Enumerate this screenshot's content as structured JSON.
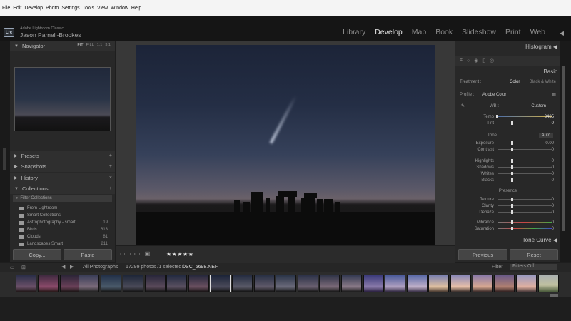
{
  "menubar": {
    "items": [
      "File",
      "Edit",
      "Develop",
      "Photo",
      "Settings",
      "Tools",
      "View",
      "Window",
      "Help"
    ]
  },
  "identity": {
    "logo": "Lrc",
    "app_name": "Adobe Lightroom Classic",
    "user": "Jason Parnell-Brookes"
  },
  "modules": {
    "items": [
      "Library",
      "Develop",
      "Map",
      "Book",
      "Slideshow",
      "Print",
      "Web"
    ],
    "active": "Develop"
  },
  "left": {
    "navigator": {
      "label": "Navigator",
      "options": [
        "FIT",
        "FILL",
        "1:1",
        "3:1"
      ]
    },
    "panels": [
      "Presets",
      "Snapshots",
      "History",
      "Collections"
    ],
    "filter_collections": "Filter Collections",
    "collections": [
      {
        "name": "From Lightroom",
        "count": ""
      },
      {
        "name": "Smart Collections",
        "count": ""
      },
      {
        "name": "Astrophotography - smart",
        "count": "19"
      },
      {
        "name": "Birds",
        "count": "613"
      },
      {
        "name": "Clouds",
        "count": "81"
      },
      {
        "name": "Landscapes Smart",
        "count": "211"
      }
    ],
    "copy": "Copy...",
    "paste": "Paste"
  },
  "center": {
    "rating": "★★★★★"
  },
  "right": {
    "histogram": "Histogram",
    "basic": "Basic",
    "treatment": {
      "label": "Treatment :",
      "color": "Color",
      "bw": "Black & White"
    },
    "profile": {
      "label": "Profile :",
      "value": "Adobe Color"
    },
    "wb": {
      "label": "WB :",
      "value": "Custom"
    },
    "temp": {
      "label": "Temp",
      "value": "3485"
    },
    "tint": {
      "label": "Tint",
      "value": "0"
    },
    "tone": {
      "label": "Tone",
      "auto": "Auto"
    },
    "exposure": {
      "label": "Exposure",
      "value": "0.00"
    },
    "contrast": {
      "label": "Contrast",
      "value": "0"
    },
    "highlights": {
      "label": "Highlights",
      "value": "0"
    },
    "shadows": {
      "label": "Shadows",
      "value": "0"
    },
    "whites": {
      "label": "Whites",
      "value": "0"
    },
    "blacks": {
      "label": "Blacks",
      "value": "0"
    },
    "presence": "Presence",
    "texture": {
      "label": "Texture",
      "value": "0"
    },
    "clarity": {
      "label": "Clarity",
      "value": "0"
    },
    "dehaze": {
      "label": "Dehaze",
      "value": "0"
    },
    "vibrance": {
      "label": "Vibrance",
      "value": "0"
    },
    "saturation": {
      "label": "Saturation",
      "value": "0"
    },
    "tone_curve": "Tone Curve",
    "previous": "Previous",
    "reset": "Reset"
  },
  "filmbar": {
    "source": "All Photographs",
    "info": "17299 photos /1 selected /",
    "file": "DSC_6698.NEF",
    "filter_label": "Filter :",
    "filter_value": "Filters Off"
  },
  "colors": {
    "accent": "#e6e6e6",
    "panel": "#282828"
  }
}
